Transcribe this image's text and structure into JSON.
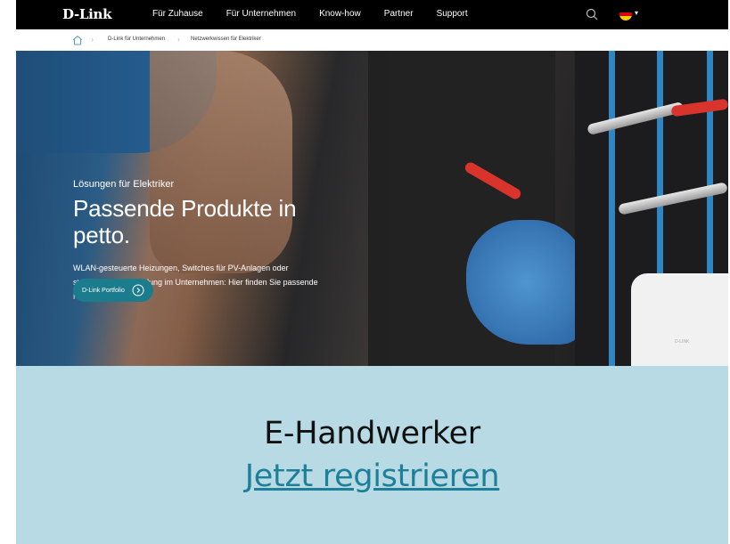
{
  "brand": {
    "logo_text": "D-Link"
  },
  "nav": {
    "items": [
      "Für Zuhause",
      "Für Unternehmen",
      "Know-how",
      "Partner",
      "Support"
    ]
  },
  "breadcrumb": {
    "items": [
      "D-Link für Unternehmen",
      "Netzwerkwissen für Elektriker"
    ]
  },
  "hero": {
    "eyebrow": "Lösungen für Elektriker",
    "title": "Passende Produkte in petto.",
    "description": "WLAN-gesteuerte Heizungen, Switches für PV-Anlagen oder strukturierte Verkabelung im Unternehmen: Hier finden Sie passende Netzwerkprodukte.",
    "button_label": "D-Link Portfolio",
    "product_label": "D-LINK"
  },
  "cta": {
    "title": "E-Handwerker",
    "link_text": "Jetzt registrieren"
  },
  "colors": {
    "topnav_bg": "#000000",
    "button_bg": "#1b7c8d",
    "cta_bg": "#b7dae4",
    "cta_link": "#1e7f99"
  },
  "icons": [
    "home-icon",
    "search-icon",
    "german-flag-icon",
    "chevron-down-icon",
    "chevron-right-icon",
    "arrow-circle-right-icon"
  ]
}
